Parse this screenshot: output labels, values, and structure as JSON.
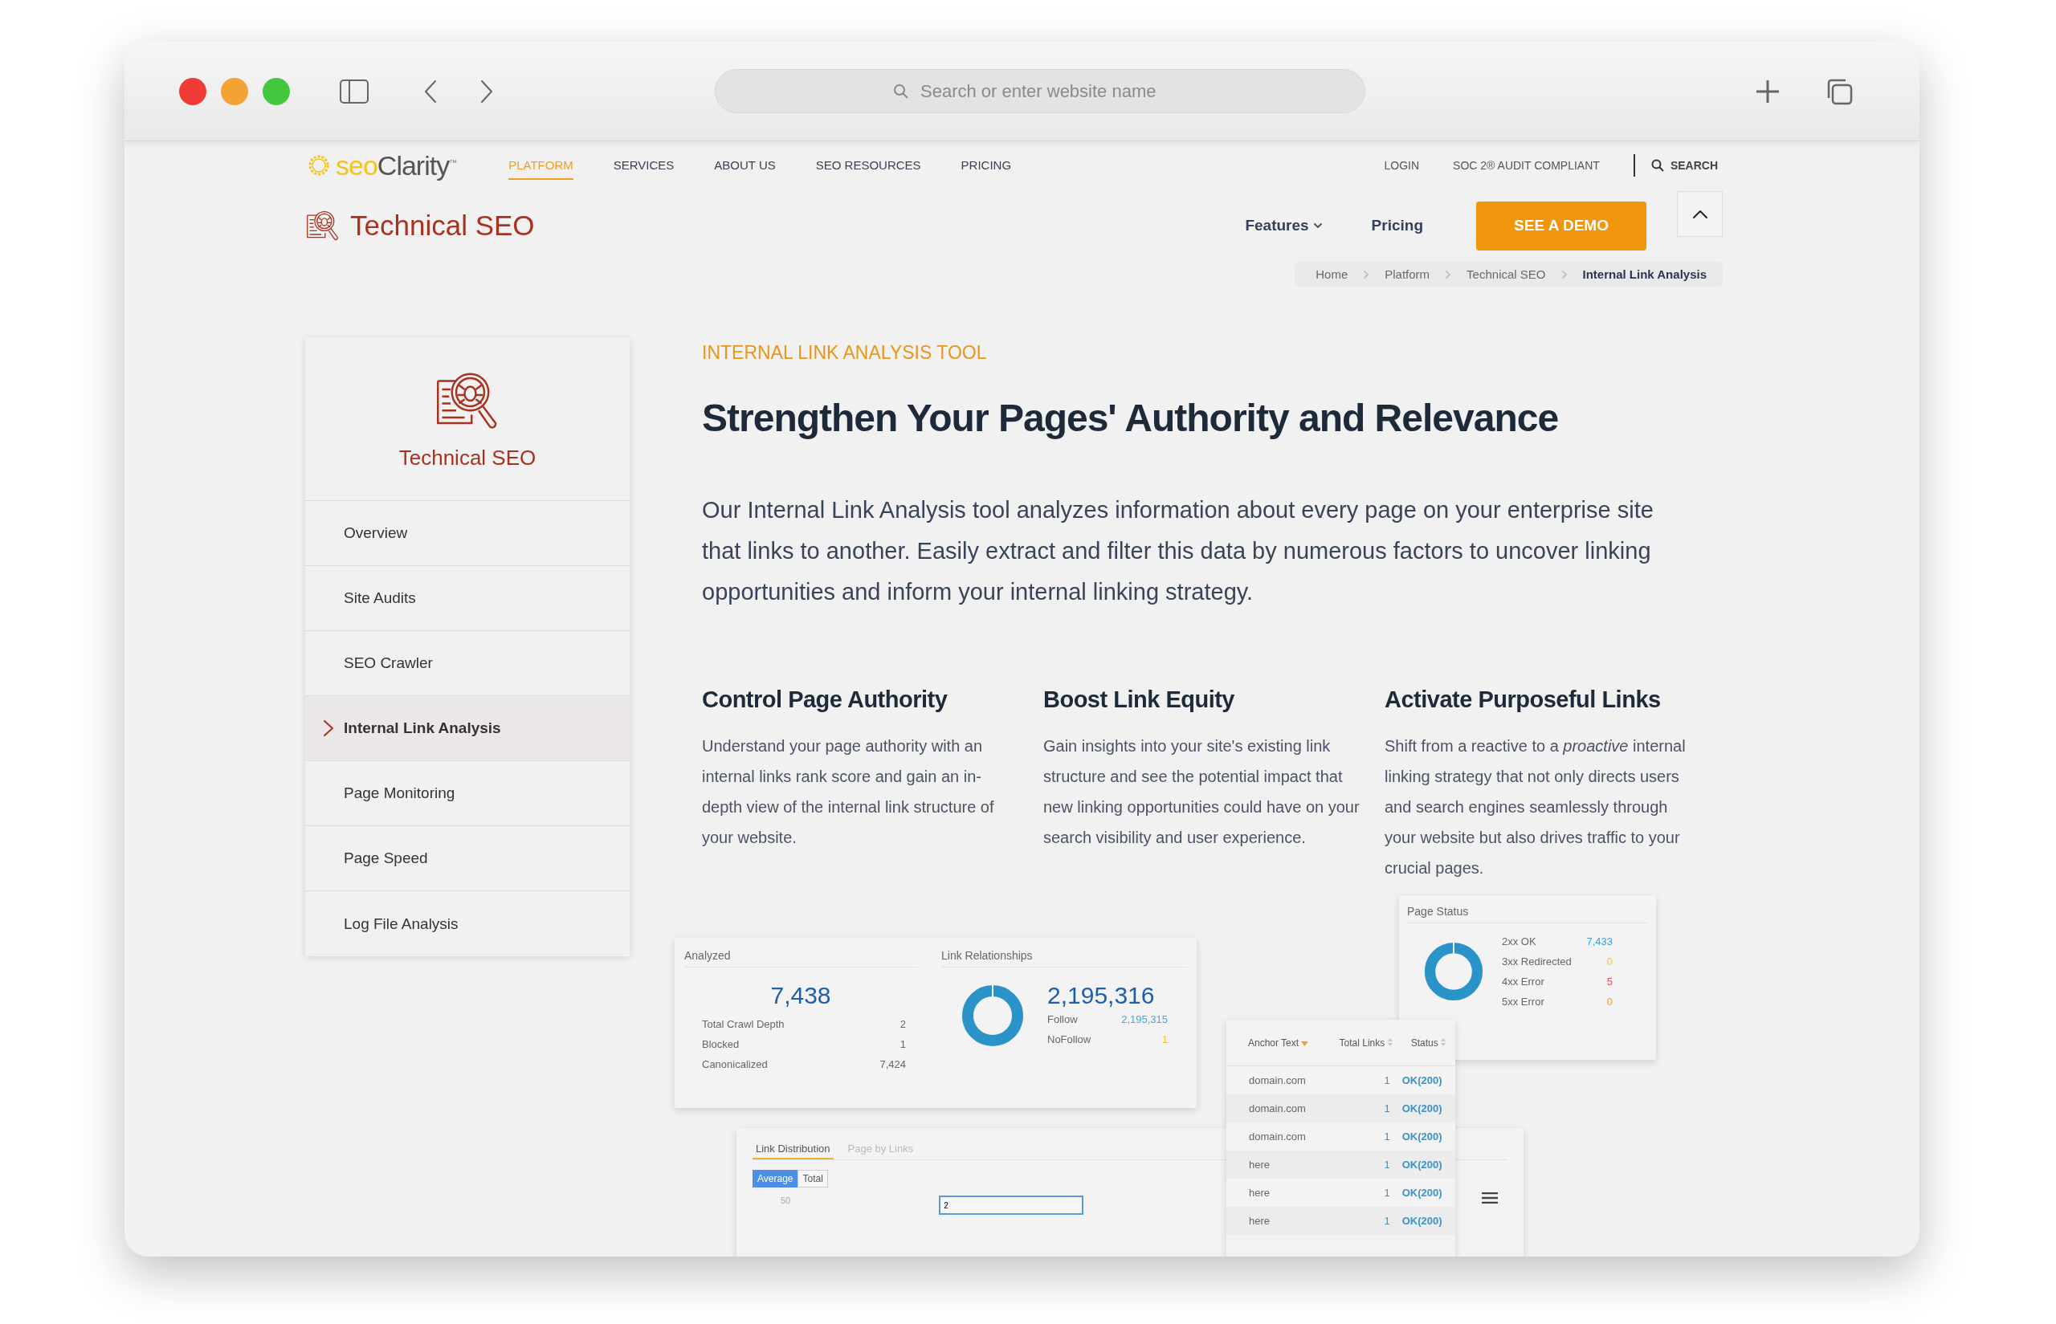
{
  "browser": {
    "address_placeholder": "Search or enter website name"
  },
  "site_nav": {
    "logo": {
      "text_a": "seo",
      "text_b": "Clarity",
      "mark": "™"
    },
    "items": [
      {
        "label": "PLATFORM",
        "selected": true
      },
      {
        "label": "SERVICES",
        "selected": false
      },
      {
        "label": "ABOUT US",
        "selected": false
      },
      {
        "label": "SEO RESOURCES",
        "selected": false
      },
      {
        "label": "PRICING",
        "selected": false
      }
    ],
    "utility": [
      "LOGIN",
      "SOC 2® AUDIT COMPLIANT"
    ],
    "search": "SEARCH"
  },
  "product_bar": {
    "title": "Technical SEO",
    "links": [
      {
        "label": "Features",
        "kind": "dropdown"
      },
      {
        "label": "Pricing",
        "kind": "link"
      }
    ],
    "cta": "SEE A DEMO"
  },
  "breadcrumb": [
    {
      "label": "Home",
      "current": false
    },
    {
      "label": "Platform",
      "current": false
    },
    {
      "label": "Technical SEO",
      "current": false
    },
    {
      "label": "Internal Link Analysis",
      "current": true
    }
  ],
  "sidebar": {
    "title": "Technical SEO",
    "items": [
      {
        "label": "Overview",
        "selected": false
      },
      {
        "label": "Site Audits",
        "selected": false
      },
      {
        "label": "SEO Crawler",
        "selected": false
      },
      {
        "label": "Internal Link Analysis",
        "selected": true
      },
      {
        "label": "Page Monitoring",
        "selected": false
      },
      {
        "label": "Page Speed",
        "selected": false
      },
      {
        "label": "Log File Analysis",
        "selected": false
      }
    ]
  },
  "main": {
    "eyebrow": "INTERNAL LINK ANALYSIS TOOL",
    "heading": "Strengthen Your Pages' Authority and Relevance",
    "intro": "Our Internal Link Analysis tool analyzes information about every page on your enterprise site that links to another. Easily extract and filter this data by numerous factors to uncover linking opportunities and inform your internal linking strategy.",
    "features": [
      {
        "title": "Control Page Authority",
        "body": "Understand your page authority with an internal links rank score and gain an in-depth view of the internal link structure of your website."
      },
      {
        "title": "Boost Link Equity",
        "body": "Gain insights into your site's existing link structure and see the potential impact that new linking opportunities could have on your search visibility and user experience."
      },
      {
        "title": "Activate Purposeful Links",
        "body": "Shift from a reactive to a *proactive* internal linking strategy that not only directs users and search engines seamlessly through your website but also drives traffic to your crucial pages."
      }
    ]
  },
  "dashboard": {
    "analyzed": {
      "title": "Analyzed",
      "total": "7,438",
      "rows": [
        {
          "label": "Total Crawl Depth",
          "value": "2"
        },
        {
          "label": "Blocked",
          "value": "1"
        },
        {
          "label": "Canonicalized",
          "value": "7,424"
        }
      ]
    },
    "link_relationships": {
      "title": "Link Relationships",
      "total": "2,195,316",
      "rows": [
        {
          "label": "Follow",
          "value": "2,195,315",
          "color": "#49a7d8"
        },
        {
          "label": "NoFollow",
          "value": "1",
          "color": "#f3b640"
        }
      ]
    },
    "page_status": {
      "title": "Page Status",
      "rows": [
        {
          "label": "2xx OK",
          "value": "7,433",
          "color": "#3fa0d6"
        },
        {
          "label": "3xx Redirected",
          "value": "0",
          "color": "#f3c060"
        },
        {
          "label": "4xx Error",
          "value": "5",
          "color": "#e94b5b"
        },
        {
          "label": "5xx Error",
          "value": "0",
          "color": "#f0a030"
        }
      ]
    },
    "link_table": {
      "columns": [
        {
          "label": "Anchor Text",
          "kind": "sorted"
        },
        {
          "label": "Total Links",
          "kind": "sortable"
        },
        {
          "label": "Status",
          "kind": "sortable"
        }
      ],
      "rows": [
        {
          "anchor": "domain.com",
          "links": "1",
          "status": "OK(200)"
        },
        {
          "anchor": "domain.com",
          "links": "1",
          "status": "OK(200)"
        },
        {
          "anchor": "domain.com",
          "links": "1",
          "status": "OK(200)"
        },
        {
          "anchor": "here",
          "links": "1",
          "status": "OK(200)"
        },
        {
          "anchor": "here",
          "links": "1",
          "status": "OK(200)"
        },
        {
          "anchor": "here",
          "links": "1",
          "status": "OK(200)"
        }
      ]
    },
    "link_distribution": {
      "tabs": [
        {
          "label": "Link Distribution",
          "selected": true
        },
        {
          "label": "Page by Links",
          "selected": false
        }
      ],
      "toggle": [
        {
          "label": "Average",
          "selected": true
        },
        {
          "label": "Total",
          "selected": false
        }
      ],
      "axis_label": "50",
      "input_value": "2"
    }
  }
}
